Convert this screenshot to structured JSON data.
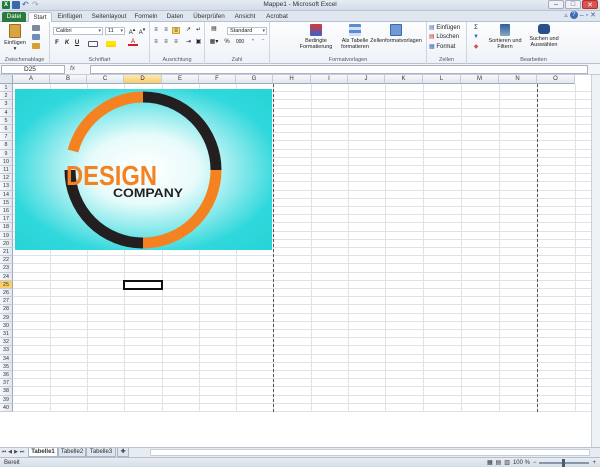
{
  "window": {
    "title": "Mappe1 - Microsoft Excel"
  },
  "ribbon_tabs": [
    "Datei",
    "Start",
    "Einfügen",
    "Seitenlayout",
    "Formeln",
    "Daten",
    "Überprüfen",
    "Ansicht",
    "Acrobat"
  ],
  "clipboard": {
    "paste_label": "Einfügen",
    "group_label": "Zwischenablage"
  },
  "font": {
    "name": "Calibri",
    "size": "11",
    "bold": "F",
    "italic": "K",
    "underline": "U",
    "group_label": "Schriftart"
  },
  "alignment": {
    "group_label": "Ausrichtung"
  },
  "number": {
    "format": "Standard",
    "percent": "%",
    "thousands": "000",
    "group_label": "Zahl"
  },
  "styles": {
    "conditional": "Bedingte Formatierung",
    "as_table": "Als Tabelle formatieren",
    "cell_styles": "Zellenformatvorlagen",
    "group_label": "Formatvorlagen"
  },
  "cells": {
    "insert": "Einfügen",
    "delete": "Löschen",
    "format": "Format",
    "group_label": "Zellen"
  },
  "editing": {
    "sigma": "Σ",
    "sort": "Sortieren und Filtern",
    "find": "Suchen und Auswählen",
    "group_label": "Bearbeiten"
  },
  "formula_bar": {
    "name_box": "D25",
    "fx": "fx",
    "value": ""
  },
  "columns": [
    "A",
    "B",
    "C",
    "D",
    "E",
    "F",
    "G",
    "H",
    "I",
    "J",
    "K",
    "L",
    "M",
    "N",
    "O"
  ],
  "rows": [
    "1",
    "2",
    "3",
    "4",
    "5",
    "6",
    "7",
    "8",
    "9",
    "10",
    "11",
    "12",
    "13",
    "14",
    "15",
    "16",
    "17",
    "18",
    "19",
    "20",
    "21",
    "22",
    "23",
    "24",
    "25",
    "26",
    "27",
    "28",
    "29",
    "30",
    "31",
    "32",
    "33",
    "34",
    "35",
    "36",
    "37",
    "38",
    "39",
    "40"
  ],
  "selected": {
    "column": "D",
    "row": "25"
  },
  "logo": {
    "word1": "DESIGN",
    "word2": "COMPANY",
    "orange": "#f58220",
    "dark": "#231f20",
    "teal": "#2bd6d8"
  },
  "sheets": [
    "Tabelle1",
    "Tabelle2",
    "Tabelle3"
  ],
  "status": {
    "left": "Bereit",
    "zoom": "100 %"
  }
}
